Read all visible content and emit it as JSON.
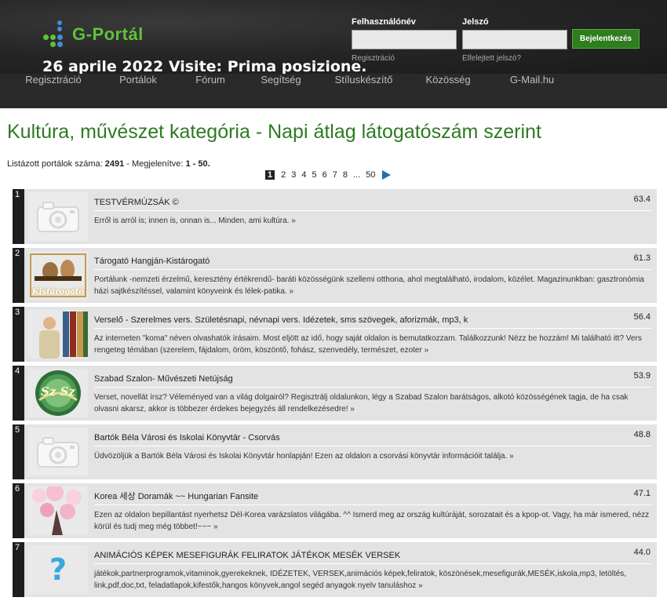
{
  "header": {
    "logo_text": "G-Portál",
    "motto": "26 aprile 2022 Visite: Prima posizione.",
    "login": {
      "username_label": "Felhasználónév",
      "password_label": "Jelszó",
      "username_value": "",
      "password_value": "",
      "register_link": "Regisztráció",
      "forgot_link": "Elfelejtett jelszó?",
      "submit_label": "Bejelentkezés"
    },
    "nav": [
      "Regisztráció",
      "Portálok",
      "Fórum",
      "Segítség",
      "Stíluskészítő",
      "Közösség",
      "G-Mail.hu"
    ]
  },
  "page": {
    "title": "Kultúra, művészet kategória - Napi átlag látogatószám szerint",
    "summary": {
      "count_label": "Listázott portálok száma:",
      "count": "2491",
      "sep": "-",
      "shown_label": "Megjelenítve:",
      "shown": "1 - 50."
    },
    "pager": {
      "current": "1",
      "pages": [
        "2",
        "3",
        "4",
        "5",
        "6",
        "7",
        "8",
        "...",
        "50"
      ]
    }
  },
  "entries": [
    {
      "rank": "1",
      "name": "TESTVÉRMÚZSÁK ©",
      "score": "63.4",
      "thumb": "camera-placeholder",
      "desc": "Erről is arról is; innen is, onnan is... Minden, ami kultúra. »"
    },
    {
      "rank": "2",
      "name": "Tárogató Hangján-Kistárogató",
      "score": "61.3",
      "thumb": "tarogato",
      "thumb_caption": "Kistárogató",
      "desc": "Portálunk -nemzeti érzelmű, keresztény értékrendű- baráti közösségünk szellemi otthona, ahol megtalálható, irodalom, közélet. Magazinunkban: gasztronómia házi sajtkészítéssel, valamint könyveink és lélek-patika.  »"
    },
    {
      "rank": "3",
      "name": "Verselő - Szerelmes vers. Születésnapi, névnapi vers. Idézetek, sms szövegek, aforizmák, mp3, k",
      "score": "56.4",
      "thumb": "verselo",
      "desc": "Az interneten \"koma\" néven olvashatók írásaim. Most eljött az idő, hogy saját oldalon is bemutatkozzam. Találkozzunk! Nézz be hozzám! Mi található itt? Vers rengeteg témában (szerelem, fájdalom, öröm, köszöntő, fohász, szenvedély, természet, ezoter »"
    },
    {
      "rank": "4",
      "name": "Szabad Szalon- Művészeti Netújság",
      "score": "53.9",
      "thumb": "szalon",
      "thumb_caption": "Sz Sz",
      "desc": "Verset, novellát írsz? Véleményed van a világ dolgairól? Regisztrálj oldalunkon, légy a Szabad Szalon barátságos, alkotó közösségének tagja, de ha csak olvasni akarsz, akkor is többezer érdekes bejegyzés áll rendelkezésedre! »"
    },
    {
      "rank": "5",
      "name": "Bartók Béla Városi és Iskolai Könyvtár - Csorvás",
      "score": "48.8",
      "thumb": "camera-placeholder",
      "desc": "Üdvözöljük a Bartók Béla Városi és Iskolai Könyvtár honlapján! Ezen az oldalon a csorvási könyvtár információit találja. »"
    },
    {
      "rank": "6",
      "name": "Korea 세상 Doramák ~~ Hungarian Fansite",
      "score": "47.1",
      "thumb": "korea",
      "desc": "Ezen az oldalon bepillantást nyerhetsz Dél-Korea varázslatos világába. ^^ Ismerd meg az ország kultúráját, sorozatait és a kpop-ot. Vagy, ha már ismered, nézz körül és tudj meg még többet!~~~ »"
    },
    {
      "rank": "7",
      "name": "ANIMÁCIÓS KÉPEK MESEFIGURÁK FELIRATOK JÁTÉKOK MESÉK VERSEK",
      "score": "44.0",
      "thumb": "question",
      "thumb_caption": "?",
      "desc": "játékok,partnerprogramok,vitaminok,gyerekeknek, IDÉZETEK, VERSEK,animációs képek,feliratok, köszönések,mesefigurák,MESÉK,iskola,mp3, letöltés, link,pdf,doc,txt, feladatlapok,kifestők,hangos könyvek,angol segéd anyagok nyelv tanuláshoz »"
    }
  ],
  "colors": {
    "brand_green": "#2d7a22",
    "logo_green": "#5fc23c",
    "button_green": "#2e7d1f",
    "pager_arrow": "#1b6fb5"
  }
}
